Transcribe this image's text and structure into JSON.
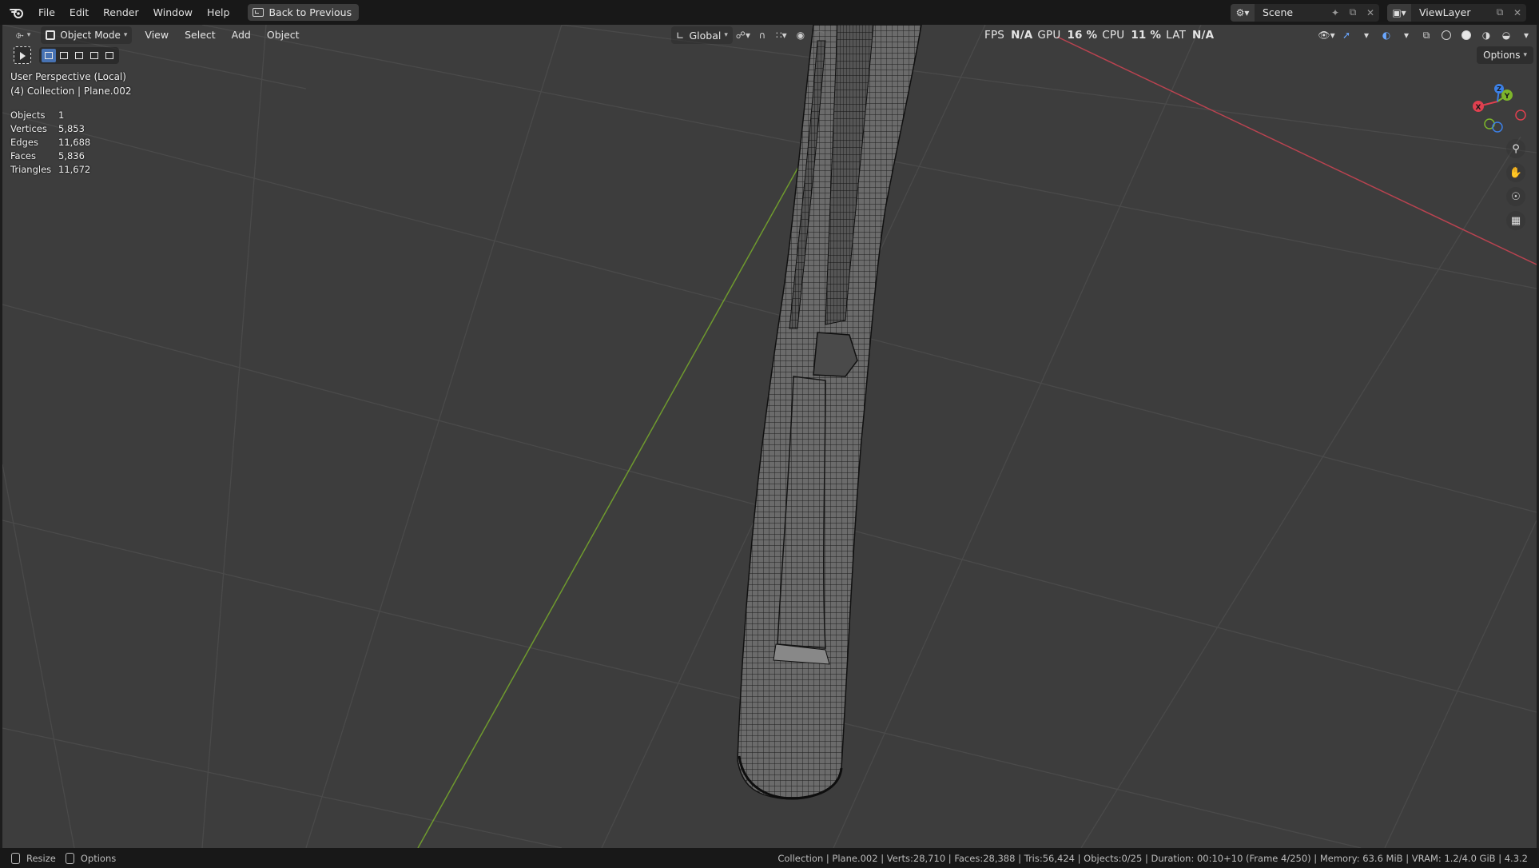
{
  "menubar": {
    "items": [
      "File",
      "Edit",
      "Render",
      "Window",
      "Help"
    ],
    "back_button": "Back to Previous"
  },
  "topright": {
    "scene": "Scene",
    "view_layer": "ViewLayer"
  },
  "viewport_header": {
    "mode": "Object Mode",
    "menus": [
      "View",
      "Select",
      "Add",
      "Object"
    ],
    "transform_orientation": "Global",
    "options_label": "Options"
  },
  "perf": {
    "fps_label": "FPS",
    "fps_value": "N/A",
    "gpu_label": "GPU",
    "gpu_value": "16 %",
    "cpu_label": "CPU",
    "cpu_value": "11 %",
    "lat_label": "LAT",
    "lat_value": "N/A"
  },
  "overlay": {
    "view_title": "User Perspective (Local)",
    "collection_line": "(4) Collection | Plane.002",
    "stats": [
      {
        "label": "Objects",
        "value": "1"
      },
      {
        "label": "Vertices",
        "value": "5,853"
      },
      {
        "label": "Edges",
        "value": "11,688"
      },
      {
        "label": "Faces",
        "value": "5,836"
      },
      {
        "label": "Triangles",
        "value": "11,672"
      }
    ]
  },
  "gizmo": {
    "x_label": "X",
    "y_label": "Y",
    "z_label": "Z",
    "x_color": "#e0404f",
    "y_color": "#7db52b",
    "z_color": "#3c80e6"
  },
  "icons": {
    "navigation": [
      "zoom-icon",
      "hand-pan-icon",
      "camera-orbit-icon",
      "grid-ortho-icon"
    ]
  },
  "statusbar": {
    "left_1": "Resize",
    "left_2": "Options",
    "right": "Collection | Plane.002 | Verts:28,710 | Faces:28,388 | Tris:56,424 | Objects:0/25 | Duration: 00:10+10 (Frame 4/250) | Memory: 63.6 MiB | VRAM: 1.2/4.0 GiB | 4.3.2"
  }
}
